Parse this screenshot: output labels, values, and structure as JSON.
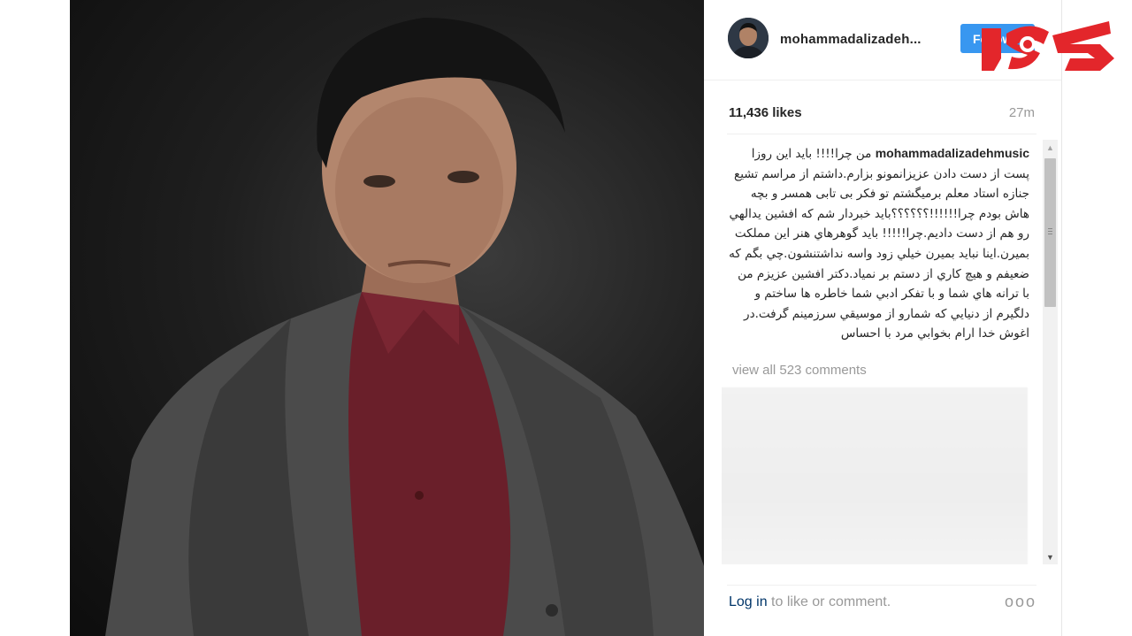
{
  "post": {
    "username": "mohammadalizadeh...",
    "follow_label": "Follow",
    "likes": "11,436 likes",
    "time": "27m",
    "caption_user": "mohammadalizadehmusic",
    "caption_text": "من چرا!!!! باید این روزا پست از دست دادن عزیزانمونو بزارم.داشتم از مراسم تشیع جنازه استاد معلم برمیگشتم تو فکر بی تابی همسر و بچه هاش بودم چرا!!!!!!؟؟؟؟؟؟باید خبردار شم که افشین یدالهي رو هم از دست دادیم.چرا!!!!! باید گوهرهاي هنر این مملکت بمیرن.اینا نباید بمیرن خیلي زود واسه نداشتنشون.چي بگم که ضعیفم و هیچ کاري از دستم بر نمیاد.دکتر افشین عزیزم من با ترانه هاي شما و با تفکر ادبي شما خاطره ها ساختم و دلگیرم از دنیایي که شمارو از موسیقي سرزمینم گرفت.در اغوش خدا ارام بخوابي مرد با احساس",
    "view_all": "view all 523 comments",
    "login_link": "Log in",
    "login_rest": " to like or comment.",
    "more_icon": "ooo"
  },
  "icons": {
    "scroll_up": "▲",
    "scroll_down": "▼"
  },
  "colors": {
    "follow": "#3897f0",
    "logo_red": "#e3262b"
  }
}
